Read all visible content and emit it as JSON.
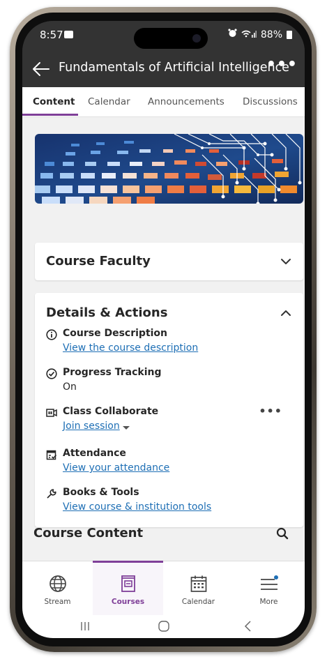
{
  "status_bar": {
    "time": "8:57",
    "battery": "88%"
  },
  "header": {
    "title": "Fundamentals of Artificial Intelligence",
    "more": "•••"
  },
  "tabs": [
    {
      "label": "Content",
      "active": true
    },
    {
      "label": "Calendar",
      "active": false
    },
    {
      "label": "Announcements",
      "active": false
    },
    {
      "label": "Discussions",
      "active": false
    }
  ],
  "faculty": {
    "title": "Course Faculty"
  },
  "details": {
    "title": "Details & Actions",
    "items": [
      {
        "label": "Course Description",
        "link": "View the course description"
      },
      {
        "label": "Progress Tracking",
        "value": "On"
      },
      {
        "label": "Class Collaborate",
        "link": "Join session"
      },
      {
        "label": "Attendance",
        "link": "View your attendance"
      },
      {
        "label": "Books & Tools",
        "link": "View course & institution tools"
      }
    ]
  },
  "course_content": {
    "title": "Course Content"
  },
  "bottom_nav": [
    {
      "label": "Stream",
      "icon": "globe-icon"
    },
    {
      "label": "Courses",
      "icon": "courses-icon",
      "active": true
    },
    {
      "label": "Calendar",
      "icon": "calendar-icon"
    },
    {
      "label": "More",
      "icon": "menu-icon"
    }
  ],
  "colors": {
    "accent": "#7f3f98",
    "link": "#1e6fb5",
    "header_bg": "#333333"
  }
}
